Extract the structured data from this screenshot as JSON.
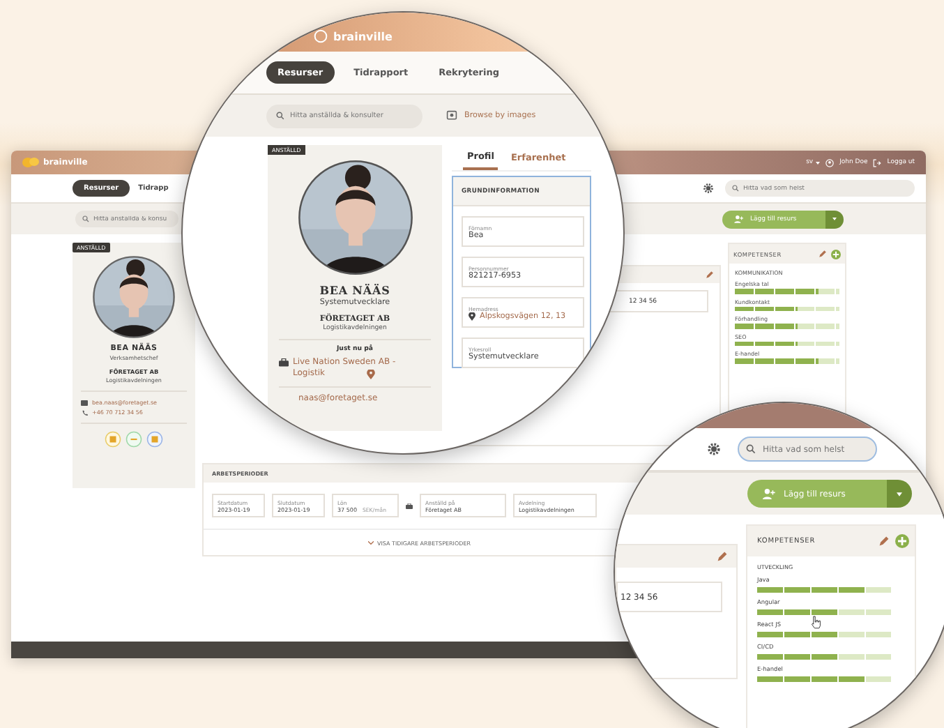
{
  "main_window": {
    "brand": "brainville",
    "language": "sv",
    "user": "John Doe",
    "logout": "Logga ut",
    "nav": [
      {
        "label": "Resurser",
        "selected": true
      },
      {
        "label": "Tidrapp",
        "selected": false
      }
    ],
    "search": {
      "placeholder": "Hitta anställda & konsu"
    },
    "global_search": {
      "placeholder": "Hitta vad som helst"
    },
    "add_button": "Lägg till resurs",
    "profile": {
      "badge": "ANSTÄLLD",
      "name": "BEA NÄÄS",
      "title": "Verksamhetschef",
      "company": "FÖRETAGET AB",
      "department": "Logistikavdelningen",
      "email": "bea.naas@foretaget.se",
      "phone": "+46 70 712 34 56"
    },
    "phone_partial": "12 34 56",
    "skills": {
      "title": "KOMPETENSER",
      "category": "KOMMUNIKATION",
      "items": [
        {
          "name": "Engelska tal",
          "level": 0.8
        },
        {
          "name": "Kundkontakt",
          "level": 0.6
        },
        {
          "name": "Förhandling",
          "level": 0.6
        },
        {
          "name": "SEO",
          "level": 0.6
        },
        {
          "name": "E-handel",
          "level": 0.8
        }
      ]
    },
    "periods": {
      "title": "ARBETSPERIODER",
      "fields": [
        {
          "label": "Startdatum",
          "value": "2023-01-19"
        },
        {
          "label": "Slutdatum",
          "value": "2023-01-19"
        },
        {
          "label": "Lön",
          "value": "37 500",
          "unit": "SEK/mån"
        },
        {
          "label": "Anställd på",
          "value": "Företaget AB"
        },
        {
          "label": "Avdelning",
          "value": "Logistikavdelningen"
        }
      ],
      "more": "VISA TIDIGARE ARBETSPERIODER"
    }
  },
  "zoom_left": {
    "brand": "brainville",
    "nav": [
      {
        "label": "Resurser",
        "selected": true
      },
      {
        "label": "Tidrapport",
        "selected": false
      },
      {
        "label": "Rekrytering",
        "selected": false
      }
    ],
    "search": {
      "placeholder": "Hitta anställda & konsulter"
    },
    "browse": "Browse by images",
    "profile": {
      "badge": "ANSTÄLLD",
      "name": "BEA NÄÄS",
      "title": "Systemutvecklare",
      "company": "FÖRETAGET AB",
      "department": "Logistikavdelningen",
      "current_label": "Just nu på",
      "current": "Live Nation Sweden AB - Logistik",
      "email": "naas@foretaget.se"
    },
    "tabs": [
      {
        "label": "Profil",
        "selected": true
      },
      {
        "label": "Erfarenhet",
        "selected": false
      }
    ],
    "section": "GRUNDINFORMATION",
    "fields": [
      {
        "kind": "text",
        "label": "Förnamn",
        "value": "Bea"
      },
      {
        "kind": "text",
        "label": "Personnummer",
        "value": "821217-6953"
      },
      {
        "kind": "address",
        "label": "Hemadress",
        "value": "Alpskogsvägen 12, 13"
      },
      {
        "kind": "text",
        "label": "Yrkesroll",
        "value": "Systemutvecklare"
      }
    ]
  },
  "zoom_right": {
    "global_search": {
      "placeholder": "Hitta vad som helst"
    },
    "add_button": "Lägg till resurs",
    "phone_partial": "12 34 56",
    "skills": {
      "title": "KOMPETENSER",
      "category": "UTVECKLING",
      "items": [
        {
          "name": "Java",
          "level": 0.8
        },
        {
          "name": "Angular",
          "level": 0.6
        },
        {
          "name": "React JS",
          "level": 0.6
        },
        {
          "name": "CI/CD",
          "level": 0.6
        },
        {
          "name": "E-handel",
          "level": 0.8
        }
      ]
    }
  }
}
